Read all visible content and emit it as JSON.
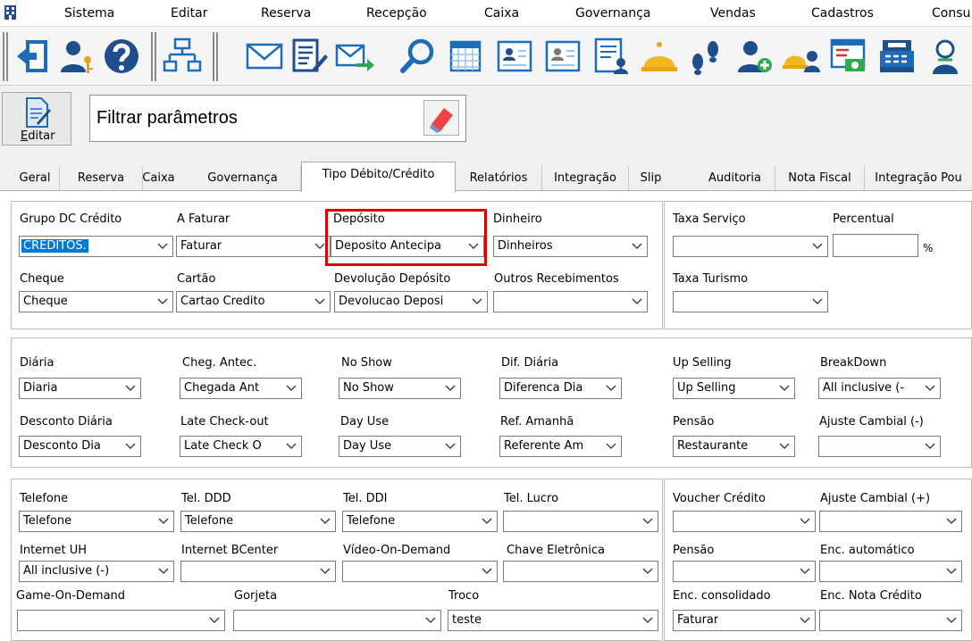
{
  "menu": [
    "Sistema",
    "Editar",
    "Reserva",
    "Recepção",
    "Caixa",
    "Governança",
    "Vendas",
    "Cadastros",
    "Consu"
  ],
  "edit_button": {
    "accel": "E",
    "rest": "ditar"
  },
  "filter": {
    "text": "Filtrar parâmetros"
  },
  "tabs": [
    "Geral",
    "Reserva",
    "Caixa",
    "Governança",
    "Tipo Débito/Crédito",
    "Relatórios",
    "Integração",
    "Slip",
    "Auditoria",
    "Nota Fiscal",
    "Integração Pou"
  ],
  "active_tab": "Tipo Débito/Crédito",
  "colors": {
    "highlight": "#e00000",
    "selection": "#0078d7",
    "accent_blue": "#0a6fbf"
  },
  "g1": {
    "grupo_dc_credito": {
      "label": "Grupo DC Crédito",
      "value": "CREDITOS."
    },
    "a_faturar": {
      "label": "A Faturar",
      "value": "Faturar"
    },
    "deposito": {
      "label": "Depósito",
      "value": "Deposito Antecipa"
    },
    "dinheiro": {
      "label": "Dinheiro",
      "value": "Dinheiros"
    },
    "cheque": {
      "label": "Cheque",
      "value": "Cheque"
    },
    "cartao": {
      "label": "Cartão",
      "value": "Cartao Credito"
    },
    "devolucao_deposito": {
      "label": "Devolução Depósito",
      "value": "Devolucao Deposi"
    },
    "outros_recebimentos": {
      "label": "Outros Recebimentos",
      "value": ""
    }
  },
  "g1r": {
    "taxa_servico": {
      "label": "Taxa Serviço",
      "value": ""
    },
    "percentual": {
      "label": "Percentual",
      "value": "",
      "unit": "%"
    },
    "taxa_turismo": {
      "label": "Taxa Turismo",
      "value": ""
    }
  },
  "g2": {
    "diaria": {
      "label": "Diária",
      "value": "Diaria"
    },
    "cheg_antec": {
      "label": "Cheg. Antec.",
      "value": "Chegada Ant"
    },
    "no_show": {
      "label": "No Show",
      "value": "No Show"
    },
    "dif_diaria": {
      "label": "Dif. Diária",
      "value": "Diferenca Dia"
    },
    "up_selling": {
      "label": "Up Selling",
      "value": "Up Selling"
    },
    "breakdown": {
      "label": "BreakDown",
      "value": "All inclusive (-"
    },
    "desconto_diaria": {
      "label": "Desconto Diária",
      "value": "Desconto Dia"
    },
    "late_checkout": {
      "label": "Late Check-out",
      "value": "Late Check O"
    },
    "day_use": {
      "label": "Day Use",
      "value": "Day Use"
    },
    "ref_amanha": {
      "label": "Ref. Amanhã",
      "value": "Referente Am"
    },
    "pensao": {
      "label": "Pensão",
      "value": "Restaurante"
    },
    "ajuste_cambial_menos": {
      "label": "Ajuste Cambial (-)",
      "value": ""
    }
  },
  "g3": {
    "telefone": {
      "label": "Telefone",
      "value": "Telefone"
    },
    "tel_ddd": {
      "label": "Tel. DDD",
      "value": "Telefone"
    },
    "tel_ddi": {
      "label": "Tel. DDI",
      "value": "Telefone"
    },
    "tel_lucro": {
      "label": "Tel. Lucro",
      "value": ""
    },
    "internet_uh": {
      "label": "Internet UH",
      "value": "All inclusive (-)"
    },
    "internet_bcenter": {
      "label": "Internet BCenter",
      "value": ""
    },
    "video_on_demand": {
      "label": "Vídeo-On-Demand",
      "value": ""
    },
    "chave_eletronica": {
      "label": "Chave Eletrônica",
      "value": ""
    },
    "game_on_demand": {
      "label": "Game-On-Demand",
      "value": ""
    },
    "gorjeta": {
      "label": "Gorjeta",
      "value": ""
    },
    "troco": {
      "label": "Troco",
      "value": "teste"
    }
  },
  "g3r": {
    "voucher_credito": {
      "label": "Voucher Crédito",
      "value": ""
    },
    "ajuste_cambial_mais": {
      "label": "Ajuste Cambial (+)",
      "value": ""
    },
    "pensao": {
      "label": "Pensão",
      "value": ""
    },
    "enc_automatico": {
      "label": "Enc. automático",
      "value": ""
    },
    "enc_consolidado": {
      "label": "Enc. consolidado",
      "value": "Faturar"
    },
    "enc_nota_credito": {
      "label": "Enc. Nota Crédito",
      "value": ""
    }
  }
}
